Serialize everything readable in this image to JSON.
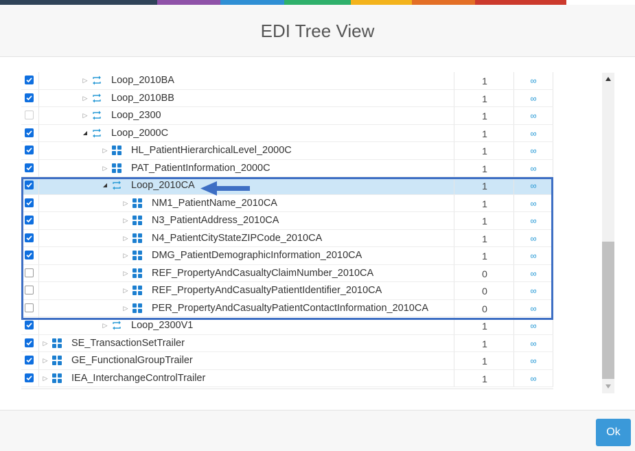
{
  "dialog": {
    "title": "EDI Tree View",
    "ok_label": "Ok"
  },
  "stripe_colors": [
    "#2f4358",
    "#8f52a8",
    "#2f8fd4",
    "#2fb06b",
    "#f3b31c",
    "#e36f26",
    "#cc3a2d"
  ],
  "icons": {
    "loop": "loop-repeat-icon",
    "segment": "segment-grid-icon",
    "link": "infinity-link-icon",
    "expand": "triangle-expand-icon"
  },
  "colors": {
    "accent": "#3b99d9",
    "checkbox": "#0f6fdf",
    "selection": "#cde6f7",
    "highlight": "#3e6fc4",
    "icon_blue": "#2b9bd6"
  },
  "tree": {
    "rows": [
      {
        "label": "Loop_2010BA",
        "type": "loop",
        "level": 3,
        "expanded": false,
        "checked": true,
        "count": "1",
        "link": "∞"
      },
      {
        "label": "Loop_2010BB",
        "type": "loop",
        "level": 3,
        "expanded": false,
        "checked": true,
        "count": "1",
        "link": "∞"
      },
      {
        "label": "Loop_2300",
        "type": "loop",
        "level": 3,
        "expanded": false,
        "checked": false,
        "disabled": true,
        "count": "1",
        "link": "∞"
      },
      {
        "label": "Loop_2000C",
        "type": "loop",
        "level": 3,
        "expanded": true,
        "checked": true,
        "count": "1",
        "link": "∞"
      },
      {
        "label": "HL_PatientHierarchicalLevel_2000C",
        "type": "segment",
        "level": 4,
        "expanded": false,
        "checked": true,
        "count": "1",
        "link": "∞"
      },
      {
        "label": "PAT_PatientInformation_2000C",
        "type": "segment",
        "level": 4,
        "expanded": false,
        "checked": true,
        "count": "1",
        "link": "∞"
      },
      {
        "label": "Loop_2010CA",
        "type": "loop",
        "level": 4,
        "expanded": true,
        "checked": true,
        "selected": true,
        "count": "1",
        "link": "∞"
      },
      {
        "label": "NM1_PatientName_2010CA",
        "type": "segment",
        "level": 5,
        "expanded": false,
        "checked": true,
        "count": "1",
        "link": "∞"
      },
      {
        "label": "N3_PatientAddress_2010CA",
        "type": "segment",
        "level": 5,
        "expanded": false,
        "checked": true,
        "count": "1",
        "link": "∞"
      },
      {
        "label": "N4_PatientCityStateZIPCode_2010CA",
        "type": "segment",
        "level": 5,
        "expanded": false,
        "checked": true,
        "count": "1",
        "link": "∞"
      },
      {
        "label": "DMG_PatientDemographicInformation_2010CA",
        "type": "segment",
        "level": 5,
        "expanded": false,
        "checked": true,
        "count": "1",
        "link": "∞"
      },
      {
        "label": "REF_PropertyAndCasualtyClaimNumber_2010CA",
        "type": "segment",
        "level": 5,
        "expanded": false,
        "checked": false,
        "count": "0",
        "link": "∞"
      },
      {
        "label": "REF_PropertyAndCasualtyPatientIdentifier_2010CA",
        "type": "segment",
        "level": 5,
        "expanded": false,
        "checked": false,
        "count": "0",
        "link": "∞"
      },
      {
        "label": "PER_PropertyAndCasualtyPatientContactInformation_2010CA",
        "type": "segment",
        "level": 5,
        "expanded": false,
        "checked": false,
        "count": "0",
        "link": "∞"
      },
      {
        "label": "Loop_2300V1",
        "type": "loop",
        "level": 4,
        "expanded": false,
        "checked": true,
        "count": "1",
        "link": "∞"
      },
      {
        "label": "SE_TransactionSetTrailer",
        "type": "segment",
        "level": 1,
        "expanded": false,
        "checked": true,
        "count": "1",
        "link": "∞"
      },
      {
        "label": "GE_FunctionalGroupTrailer",
        "type": "segment",
        "level": 1,
        "expanded": false,
        "checked": true,
        "count": "1",
        "link": "∞"
      },
      {
        "label": "IEA_InterchangeControlTrailer",
        "type": "segment",
        "level": 1,
        "expanded": false,
        "checked": true,
        "count": "1",
        "link": "∞"
      }
    ]
  }
}
